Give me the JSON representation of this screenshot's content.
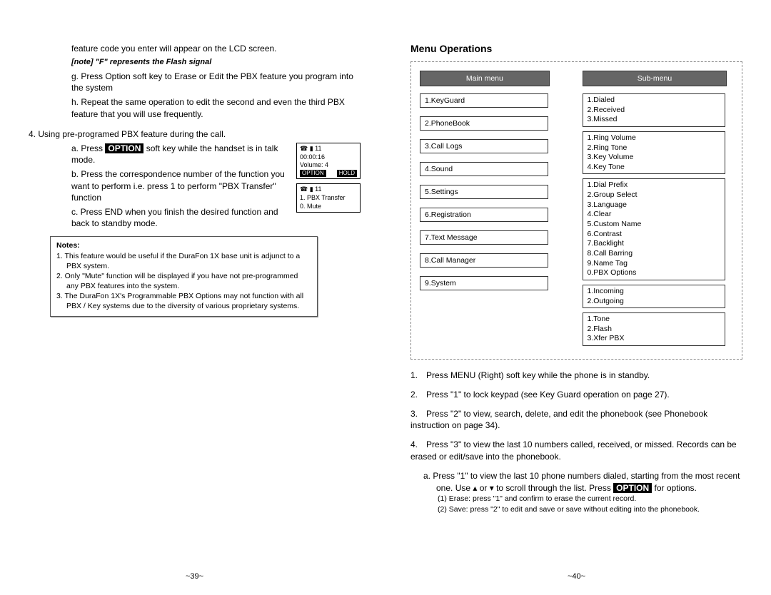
{
  "left": {
    "cont1": "feature code you enter will appear on the LCD screen.",
    "note_f": "[note] \"F\" represents the Flash signal",
    "item_g": "g.   Press Option soft key to Erase or Edit the PBX feature you program into the system",
    "item_h": "h.   Repeat the same operation to edit the second and even the third PBX feature that you will use frequently.",
    "step4": "4.    Using pre-programed PBX feature during the call.",
    "step4a_pre": "a.   Press ",
    "step4a_inv": "OPTION",
    "step4a_post": " soft key while the handset is in talk mode.",
    "step4b": "b.   Press the correspondence number of the function you want to perform i.e. press 1 to perform \"PBX Transfer\" function",
    "step4c": "c.   Press END when you finish the desired function and back to standby mode.",
    "lcd1": {
      "hdr": "☎ ▮ 11",
      "l1": "00:00:16",
      "l2": "Volume: 4",
      "b1": "OPTION",
      "b2": "HOLD"
    },
    "lcd2": {
      "hdr": "☎ ▮ 11",
      "l1": "1. PBX Transfer",
      "l2": "0. Mute"
    },
    "notes_title": "Notes:",
    "notes": [
      "1. This feature would be useful if the DuraFon 1X base unit is adjunct to a PBX system.",
      "2. Only \"Mute\" function will be displayed if you have not pre-programmed any PBX features into the system.",
      "3. The DuraFon 1X's Programmable PBX Options may not function with all PBX / Key systems due to the diversity of various proprietary systems."
    ],
    "pagenum": "~39~"
  },
  "right": {
    "title": "Menu Operations",
    "main_hdr": "Main menu",
    "sub_hdr": "Sub-menu",
    "main_items": [
      "1.KeyGuard",
      "2.PhoneBook",
      "3.Call Logs",
      "4.Sound",
      "5.Settings",
      "6.Registration",
      "7.Text Message",
      "8.Call Manager",
      "9.System"
    ],
    "sub_boxes": [
      [
        "1.Dialed",
        "2.Received",
        "3.Missed"
      ],
      [
        "1.Ring Volume",
        "2.Ring Tone",
        "3.Key Volume",
        "4.Key Tone"
      ],
      [
        "1.Dial Prefix",
        "2.Group Select",
        "3.Language",
        "4.Clear",
        "5.Custom Name",
        "6.Contrast",
        "7.Backlight",
        "8.Call Barring",
        "9.Name Tag",
        "0.PBX Options"
      ],
      [
        "1.Incoming",
        "2.Outgoing"
      ],
      [
        "1.Tone",
        "2.Flash",
        "3.Xfer PBX"
      ]
    ],
    "step1": "Press MENU (Right) soft key while the phone is in standby.",
    "step2": "Press \"1\" to lock keypad (see Key Guard operation on page 27).",
    "step3": "Press \"2\" to view, search, delete, and edit the phonebook (see Phonebook instruction on page 34).",
    "step4": "Press \"3\" to view the last 10 numbers called, received, or missed. Records can be erased or edit/save into the phonebook.",
    "step4a_pre": "a.   Press \"1\" to view the last 10 phone numbers dialed, starting from the most recent one.  Use ▴ or ▾ to scroll through the list. Press ",
    "step4a_inv": "OPTION",
    "step4a_post": " for options.",
    "step4a1": "(1)   Erase: press \"1\" and confirm to erase the current record.",
    "step4a2": "(2)   Save: press \"2\" to edit and save or save without editing into the phonebook.",
    "pagenum": "~40~"
  }
}
